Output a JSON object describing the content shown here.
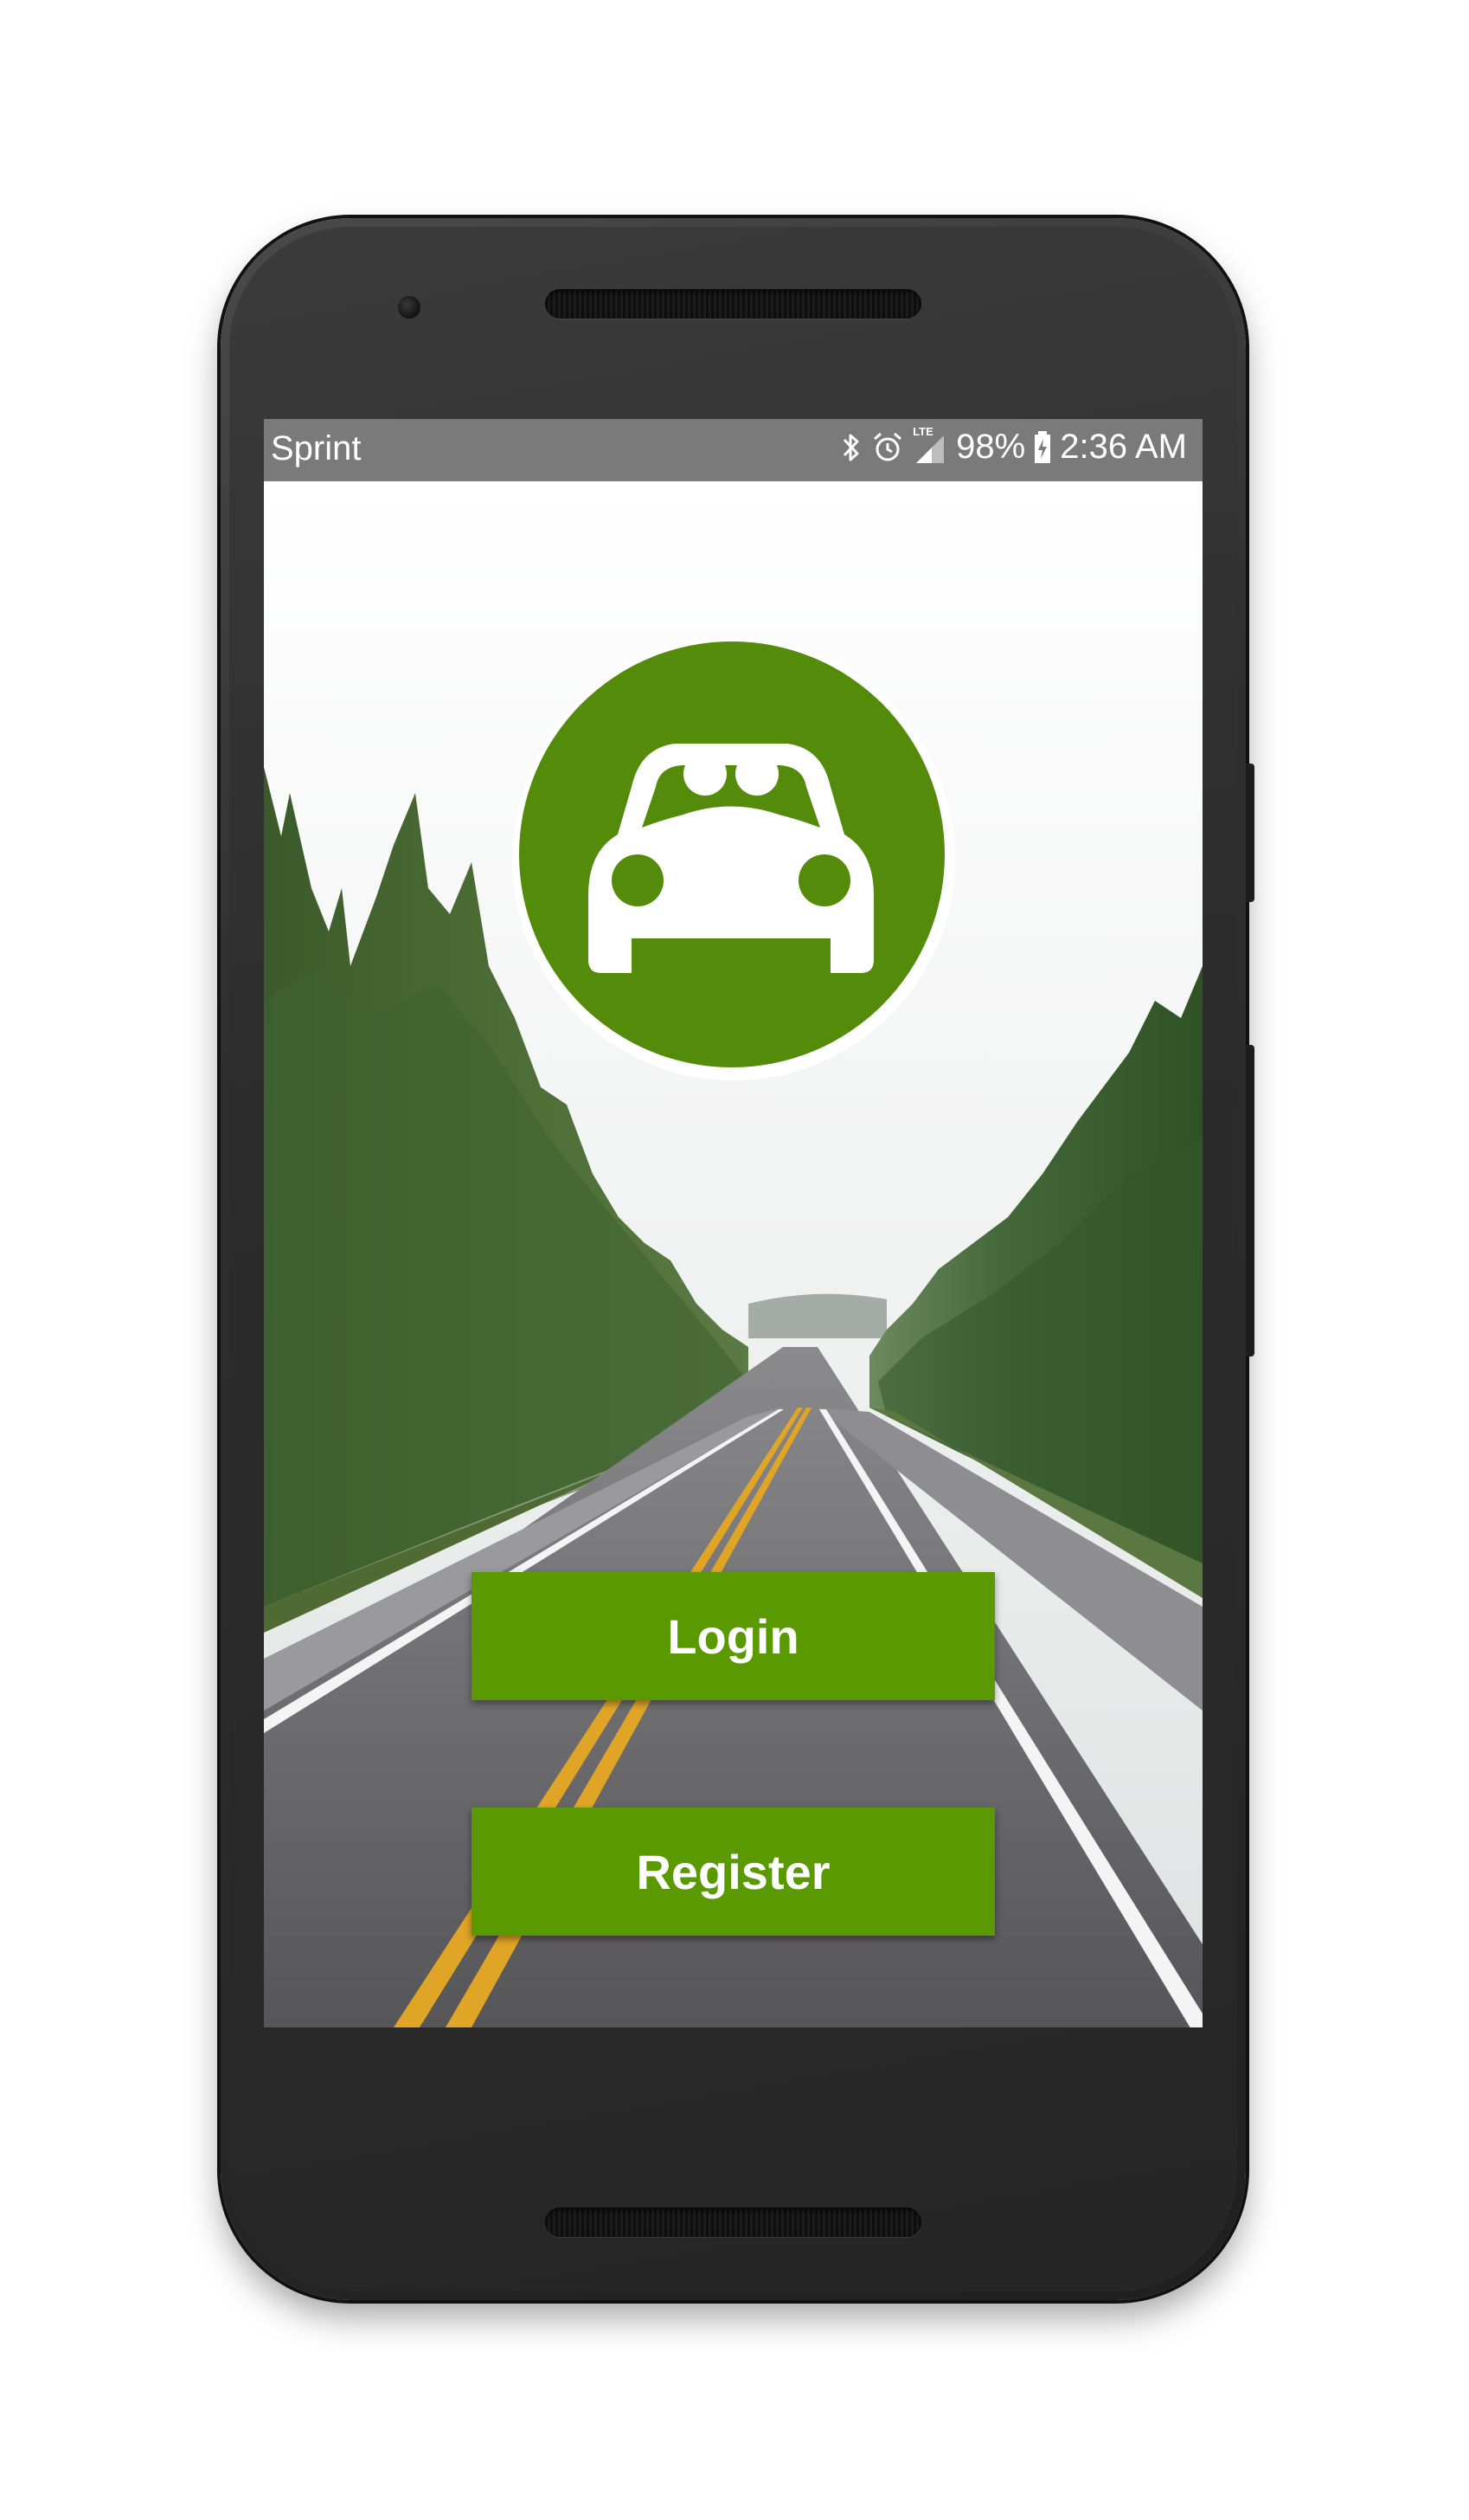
{
  "status_bar": {
    "carrier": "Sprint",
    "network_label": "LTE",
    "battery": "98%",
    "time": "2:36 AM",
    "icons": [
      "bluetooth-icon",
      "alarm-icon",
      "signal-icon",
      "battery-charging-icon"
    ]
  },
  "app": {
    "logo_icon": "car-with-passengers-icon",
    "login_label": "Login",
    "register_label": "Register"
  },
  "colors": {
    "accent": "#5a9a00",
    "logo_green": "#548b0b",
    "status_bar": "#7a7a7a"
  }
}
